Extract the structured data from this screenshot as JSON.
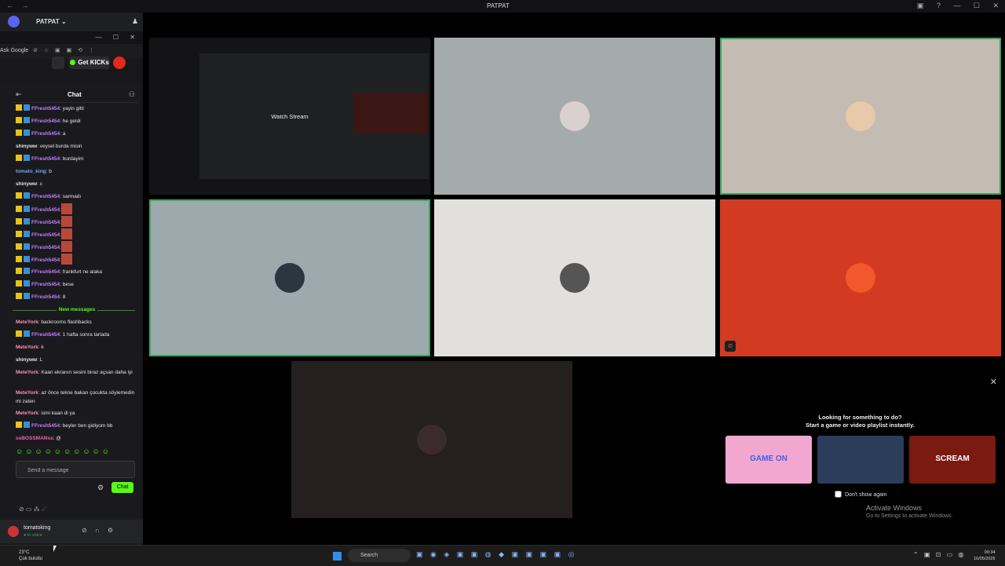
{
  "window": {
    "title": "PATPAT",
    "nav": "← →",
    "controls": "▣ ? — ☐ ✕"
  },
  "guild": {
    "name": "PATPAT ⌄",
    "icon": "user-add-icon"
  },
  "browser": {
    "controls": "— ☐ ✕",
    "address_text": "Ask Google",
    "address_icons": "⊘ ☆ ▣ ▣ ⟲ ⋮",
    "get_kicks_label": "Get KICKs"
  },
  "chat": {
    "header": "Chat",
    "messages": [
      {
        "badges": true,
        "user": "FFresh5454",
        "text": ": yayin gitti",
        "ucolor": "#c77dff"
      },
      {
        "badges": true,
        "user": "FFresh5454",
        "text": ": he geldi",
        "ucolor": "#c77dff"
      },
      {
        "badges": true,
        "user": "FFresh5454",
        "text": ": a",
        "ucolor": "#c77dff"
      },
      {
        "badges": false,
        "user": "shinyww",
        "text": ": veysel burda misin",
        "ucolor": "#e6e6e6"
      },
      {
        "badges": true,
        "user": "FFresh5454",
        "text": ": burdayim",
        "ucolor": "#c77dff"
      },
      {
        "badges": false,
        "user": "tomato_king",
        "text": ": b",
        "ucolor": "#6fa8ff"
      },
      {
        "badges": false,
        "user": "shinyww",
        "text": ": c",
        "ucolor": "#e6e6e6"
      },
      {
        "badges": true,
        "user": "FFresh5454",
        "text": ": sarmadı",
        "ucolor": "#c77dff"
      },
      {
        "badges": true,
        "user": "FFresh5454",
        "text": ":",
        "ucolor": "#c77dff",
        "emote": true
      },
      {
        "badges": true,
        "user": "FFresh5454",
        "text": ":",
        "ucolor": "#c77dff",
        "emote": true
      },
      {
        "badges": true,
        "user": "FFresh5454",
        "text": ":",
        "ucolor": "#c77dff",
        "emote": true
      },
      {
        "badges": true,
        "user": "FFresh5454",
        "text": ":",
        "ucolor": "#c77dff",
        "emote": true
      },
      {
        "badges": true,
        "user": "FFresh5454",
        "text": ":",
        "ucolor": "#c77dff",
        "emote": true
      },
      {
        "badges": true,
        "user": "FFresh5454",
        "text": ": frankfurt ne alaka",
        "ucolor": "#c77dff"
      },
      {
        "badges": true,
        "user": "FFresh5454",
        "text": ": bese",
        "ucolor": "#c77dff"
      },
      {
        "badges": true,
        "user": "FFresh5454",
        "text": ": 8",
        "ucolor": "#c77dff"
      }
    ],
    "new_messages_label": "New messages",
    "messages_after": [
      {
        "badges": false,
        "user": "MeteYork",
        "text": ": backrooms flashbacks",
        "ucolor": "#ff8fb3"
      },
      {
        "badges": true,
        "user": "FFresh5454",
        "text": ": 1 hafta sonra tarlada",
        "ucolor": "#c77dff"
      },
      {
        "badges": false,
        "user": "MeteYork",
        "text": ": k",
        "ucolor": "#ff8fb3"
      },
      {
        "badges": false,
        "user": "shinyww",
        "text": ": L",
        "ucolor": "#e6e6e6"
      },
      {
        "badges": false,
        "user": "MeteYork",
        "text": ": Kaan ekranın sesini biraz açsan daha iyi",
        "ucolor": "#ff8fb3",
        "tall": true
      },
      {
        "badges": false,
        "user": "MeteYork",
        "text": ": az önce tekne bakan çocukta söylemedin mi zaten",
        "ucolor": "#ff8fb3",
        "tall": true
      },
      {
        "badges": false,
        "user": "MeteYork",
        "text": ": ismi kaan di ya",
        "ucolor": "#ff8fb3"
      },
      {
        "badges": true,
        "user": "FFresh5454",
        "text": ": beyler ben gidiyom bb",
        "ucolor": "#c77dff"
      },
      {
        "badges": false,
        "user": "ssBOSSMANss",
        "text": ": @",
        "ucolor": "#ff5db1"
      }
    ],
    "emote_bar": "☺☺☺☺☺☺☺☺☺☺",
    "input_placeholder": "Send a message",
    "send_label": "Chat"
  },
  "voice_controls": "⊘ ▭ ⁂ ☄",
  "user": {
    "name": "tomatoking",
    "status": "● In voice",
    "controls": "⊘ ∩ ⚙"
  },
  "stage": {
    "watch_stream_label": "Watch Stream",
    "tiles": [
      {
        "bg": "#a5abab",
        "face": "#d9d0cf",
        "speaking": false
      },
      {
        "bg": "#c4bcb2",
        "face": "#e8c9a9",
        "speaking": true
      },
      {
        "bg": "#9ca9ad",
        "face": "#2a3640",
        "speaking": true
      },
      {
        "bg": "#e2e0dc",
        "face": "#555555",
        "speaking": false
      },
      {
        "bg": "#d23a22",
        "face": "#f2582b",
        "speaking": false
      },
      {
        "bg": "#251f1f",
        "face": "#3a2c2c",
        "speaking": false
      }
    ]
  },
  "activity": {
    "line1": "Looking for something to do?",
    "line2": "Start a game or video playlist instantly.",
    "games": [
      {
        "label": "GAME ON",
        "bg": "#f2a7d0",
        "fg": "#3a63e8"
      },
      {
        "label": "",
        "bg": "#2a3d5a",
        "fg": "#f0c060"
      },
      {
        "label": "SCREAM",
        "bg": "#7a1a10",
        "fg": "#ffffff"
      }
    ],
    "dont_show_label": "Don't show again"
  },
  "activate": {
    "line1": "Activate Windows",
    "line2": "Go to Settings to activate Windows."
  },
  "taskbar": {
    "weather_temp": "23°C",
    "weather_desc": "Çok bulutlu",
    "search_label": "Search",
    "apps": "▣ ◉ ◈ ▣ ▣ ◍ ◆ ▣ ▣ ▣ ▣ ◎",
    "tray": "⌃ ▣ ⊡ ▭ ◍",
    "time": "00:34",
    "date": "10/05/2026"
  }
}
